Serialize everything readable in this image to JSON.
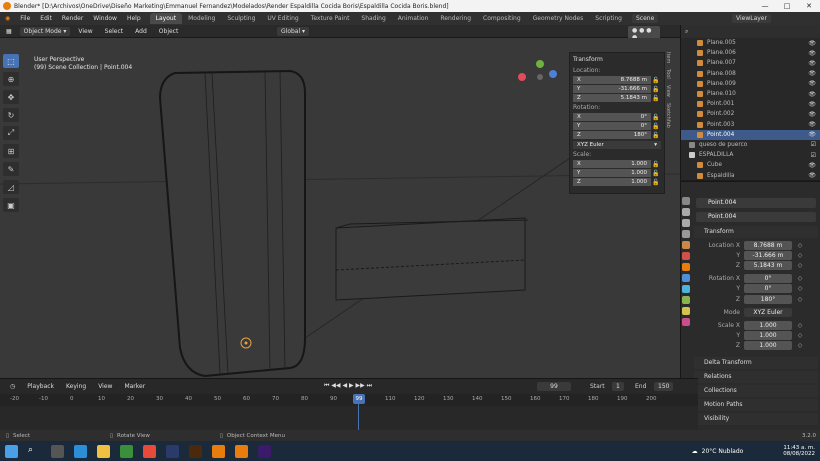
{
  "window": {
    "title": "Blender* [D:\\Archivos\\OneDrive\\Diseño Marketing\\Emmanuel Fernandez\\Modelados\\Render Espaldilla Cocida Boris\\Espaldilla Cocida Boris.blend]",
    "minimize": "—",
    "maximize": "□",
    "close": "✕"
  },
  "menu": [
    "File",
    "Edit",
    "Render",
    "Window",
    "Help"
  ],
  "workspaces": [
    "Layout",
    "Modeling",
    "Sculpting",
    "UV Editing",
    "Texture Paint",
    "Shading",
    "Animation",
    "Rendering",
    "Compositing",
    "Geometry Nodes",
    "Scripting"
  ],
  "scene": {
    "label": "Scene",
    "viewlayer": "ViewLayer"
  },
  "viewport_header": {
    "mode": "Object Mode",
    "items": [
      "View",
      "Select",
      "Add",
      "Object"
    ],
    "orientation": "Global",
    "options": "Options"
  },
  "viewport": {
    "perspective": "User Perspective",
    "collection": "(99) Scene Collection | Point.004"
  },
  "npanel": {
    "title": "Transform",
    "location_label": "Location:",
    "location": [
      "8.7688 m",
      "-31.666 m",
      "5.1843 m"
    ],
    "rotation_label": "Rotation:",
    "rotation": [
      "0°",
      "0°",
      "180°"
    ],
    "euler": "XYZ Euler",
    "scale_label": "Scale:",
    "scale": [
      "1.000",
      "1.000",
      "1.000"
    ],
    "tabs": [
      "Item",
      "Tool",
      "View",
      "Sketchfab"
    ]
  },
  "outliner": {
    "rows": [
      {
        "name": "Plane.005",
        "sel": false
      },
      {
        "name": "Plane.006",
        "sel": false
      },
      {
        "name": "Plane.007",
        "sel": false
      },
      {
        "name": "Plane.008",
        "sel": false
      },
      {
        "name": "Plane.009",
        "sel": false
      },
      {
        "name": "Plane.010",
        "sel": false
      },
      {
        "name": "Point.001",
        "sel": false
      },
      {
        "name": "Point.002",
        "sel": false
      },
      {
        "name": "Point.003",
        "sel": false
      },
      {
        "name": "Point.004",
        "sel": true
      },
      {
        "name": "queso de puerco",
        "sel": false
      },
      {
        "name": "ESPALDILLA",
        "sel": false
      },
      {
        "name": "Cube",
        "sel": false
      },
      {
        "name": "Espaldilla",
        "sel": false
      }
    ]
  },
  "properties": {
    "object": "Point.004",
    "data": "Point.004",
    "transform": "Transform",
    "loc_x_label": "Location X",
    "y_label": "Y",
    "z_label": "Z",
    "location": [
      "8.7688 m",
      "-31.666 m",
      "5.1843 m"
    ],
    "rot_x_label": "Rotation X",
    "rotation": [
      "0°",
      "0°",
      "180°"
    ],
    "mode_label": "Mode",
    "mode": "XYZ Euler",
    "scale_x_label": "Scale X",
    "scale": [
      "1.000",
      "1.000",
      "1.000"
    ],
    "sections": [
      "Delta Transform",
      "Relations",
      "Collections",
      "Motion Paths",
      "Visibility"
    ]
  },
  "timeline": {
    "items": [
      "Playback",
      "Keying",
      "View",
      "Marker"
    ],
    "frame": "99",
    "start_label": "Start",
    "start": "1",
    "end_label": "End",
    "end": "150",
    "ticks": [
      "-20",
      "-10",
      "0",
      "10",
      "20",
      "30",
      "40",
      "50",
      "60",
      "70",
      "80",
      "90",
      "110",
      "120",
      "130",
      "140",
      "150",
      "160",
      "170",
      "180",
      "190",
      "200"
    ],
    "current": "99"
  },
  "status": {
    "select": "Select",
    "rotate": "Rotate View",
    "context": "Object Context Menu",
    "version": "3.2.0"
  },
  "taskbar": {
    "weather": "20°C Nublado",
    "time": "11:43 a. m.",
    "date": "08/08/2022"
  }
}
